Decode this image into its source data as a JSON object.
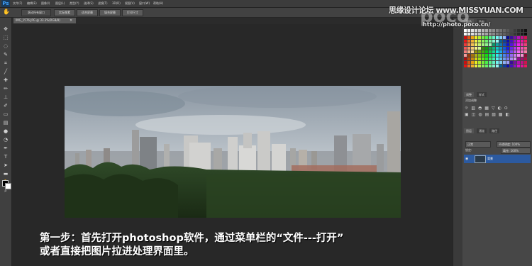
{
  "app": {
    "logo": "Ps"
  },
  "menu": {
    "items": [
      "文件(F)",
      "编辑(E)",
      "图像(I)",
      "图层(L)",
      "类型(Y)",
      "选择(S)",
      "滤镜(T)",
      "3D(D)",
      "视图(V)",
      "窗口(W)",
      "帮助(H)"
    ]
  },
  "options": {
    "buttons": [
      "滚动所有窗口",
      "实际像素",
      "适合屏幕",
      "填充屏幕",
      "打印尺寸"
    ]
  },
  "document": {
    "tab_label": "IMG_1576.JPG @ 33.3%(RGB/8)",
    "close": "×"
  },
  "panels": {
    "top_tabs": [
      "颜色",
      "色板"
    ],
    "adjust_tabs": [
      "调整",
      "样式"
    ],
    "adjust_title": "添加调整",
    "layer_tabs": [
      "图层",
      "通道",
      "路径"
    ],
    "blend_mode": "正常",
    "opacity_label": "不透明度: 100%",
    "lock_label": "锁定:",
    "fill_label": "填充: 100%",
    "layer_name": "背景"
  },
  "caption": {
    "line1": "第一步：首先打开photoshop软件，通过菜单栏的“文件---打开”",
    "line2": "或者直接把图片拉进处理界面里。"
  },
  "watermark": {
    "line1": "思缘设计论坛 www.MISSYUAN.COM",
    "poco": "poco",
    "line2": "http://photo.poco.cn/"
  },
  "colors": {
    "accent": "#2c5aa0",
    "ps_blue": "#3fa2ff"
  }
}
